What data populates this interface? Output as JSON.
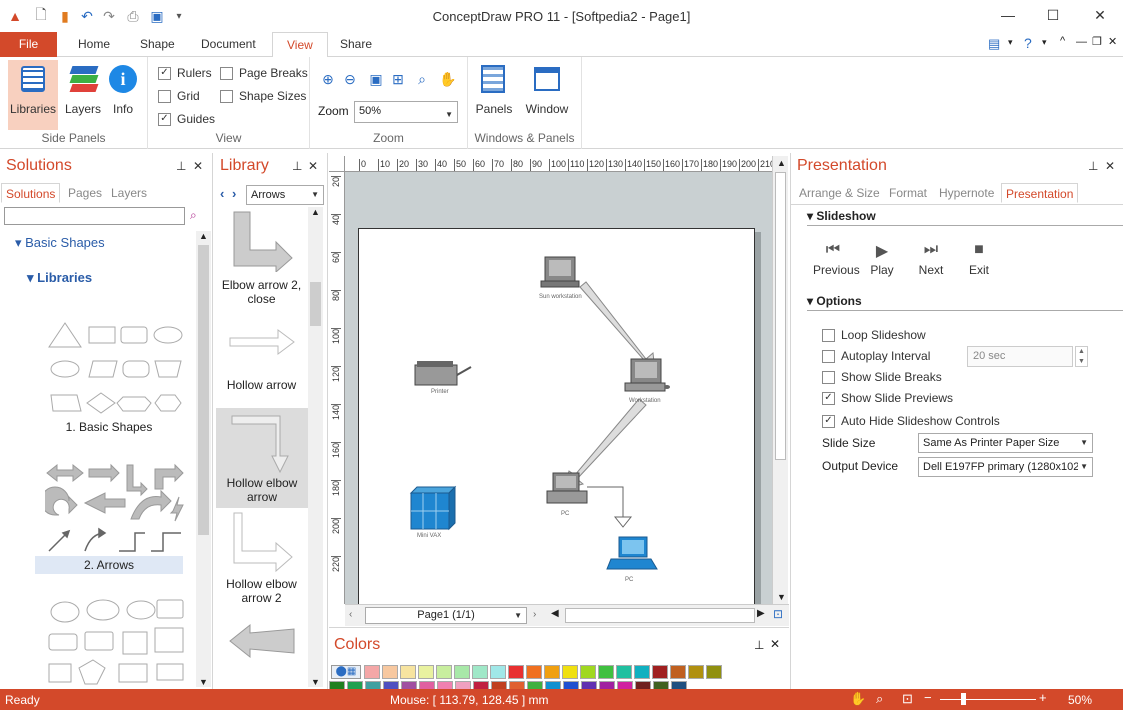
{
  "window": {
    "title": "ConceptDraw PRO 11 - [Softpedia2 - Page1]",
    "minimize": "—",
    "maximize": "☐",
    "close": "✕"
  },
  "menu": {
    "file": "File",
    "tabs": [
      "Home",
      "Shape",
      "Document",
      "View",
      "Share"
    ]
  },
  "ribbon": {
    "side_panels": {
      "label": "Side Panels",
      "libraries": "Libraries",
      "layers": "Layers",
      "info": "Info"
    },
    "view": {
      "label": "View",
      "rulers": "Rulers",
      "grid": "Grid",
      "guides": "Guides",
      "page_breaks": "Page Breaks",
      "shape_sizes": "Shape Sizes"
    },
    "zoom": {
      "label": "Zoom",
      "zoom_text": "Zoom",
      "zoom_value": "50%"
    },
    "windows": {
      "label": "Windows & Panels",
      "panels": "Panels",
      "window": "Window"
    }
  },
  "solutions": {
    "title": "Solutions",
    "tabs": [
      "Solutions",
      "Pages",
      "Layers"
    ],
    "tree_basic": "Basic Shapes",
    "tree_libraries": "Libraries",
    "item1": "1. Basic Shapes",
    "item2": "2. Arrows"
  },
  "library": {
    "title": "Library",
    "select": "Arrows",
    "items": [
      "Elbow arrow 2, close",
      "Hollow arrow",
      "Hollow elbow arrow",
      "Hollow elbow arrow 2"
    ]
  },
  "diagram": {
    "labels": [
      "Sun workstation",
      "Printer",
      "Workstation",
      "Mini VAX",
      "PC",
      "PC"
    ],
    "ruler_h": [
      "0",
      "10",
      "20",
      "30",
      "40",
      "50",
      "60",
      "70",
      "80",
      "90",
      "100",
      "110",
      "120",
      "130",
      "140",
      "150",
      "160",
      "170",
      "180",
      "190",
      "200",
      "210"
    ],
    "ruler_v": [
      "20",
      "40",
      "60",
      "80",
      "100",
      "120",
      "140",
      "160",
      "180",
      "200",
      "220"
    ],
    "page_nav": "Page1 (1/1)"
  },
  "colors": {
    "title": "Colors",
    "palette1": [
      "#f4a7a7",
      "#f7c8a0",
      "#f7e4a0",
      "#e9f2a0",
      "#c8ee9e",
      "#a8e8a8",
      "#a0e8c8",
      "#a0e8e8",
      "#e83030",
      "#f07020",
      "#f0a010",
      "#f0e010",
      "#a0d820",
      "#40c040",
      "#20c0a0",
      "#10b0c0",
      "#a02020",
      "#c06020",
      "#b09010",
      "#909010"
    ],
    "palette2": [
      "#208020",
      "#20a050",
      "#40a0a0",
      "#5050c0",
      "#a050a0",
      "#e060a0",
      "#f080b0",
      "#f0a0c0",
      "#c02040",
      "#c04020",
      "#e06030",
      "#40b040",
      "#1090d0",
      "#2050d0",
      "#6030b0",
      "#a020a0",
      "#d020a0",
      "#702020",
      "#406020",
      "#205080"
    ]
  },
  "presentation": {
    "title": "Presentation",
    "tabs": [
      "Arrange & Size",
      "Format",
      "Hypernote",
      "Presentation"
    ],
    "slideshow": "Slideshow",
    "previous": "Previous",
    "play": "Play",
    "next": "Next",
    "exit": "Exit",
    "options": "Options",
    "loop": "Loop Slideshow",
    "autoplay": "Autoplay Interval",
    "interval": "20  sec",
    "breaks": "Show Slide Breaks",
    "previews": "Show Slide Previews",
    "autohide": "Auto Hide Slideshow Controls",
    "slide_size_label": "Slide Size",
    "slide_size": "Same As Printer Paper Size",
    "output_label": "Output Device",
    "output": "Dell E197FP primary (1280x102"
  },
  "status": {
    "ready": "Ready",
    "mouse": "Mouse: [ 113.79, 128.45 ] mm",
    "zoom": "50%"
  }
}
